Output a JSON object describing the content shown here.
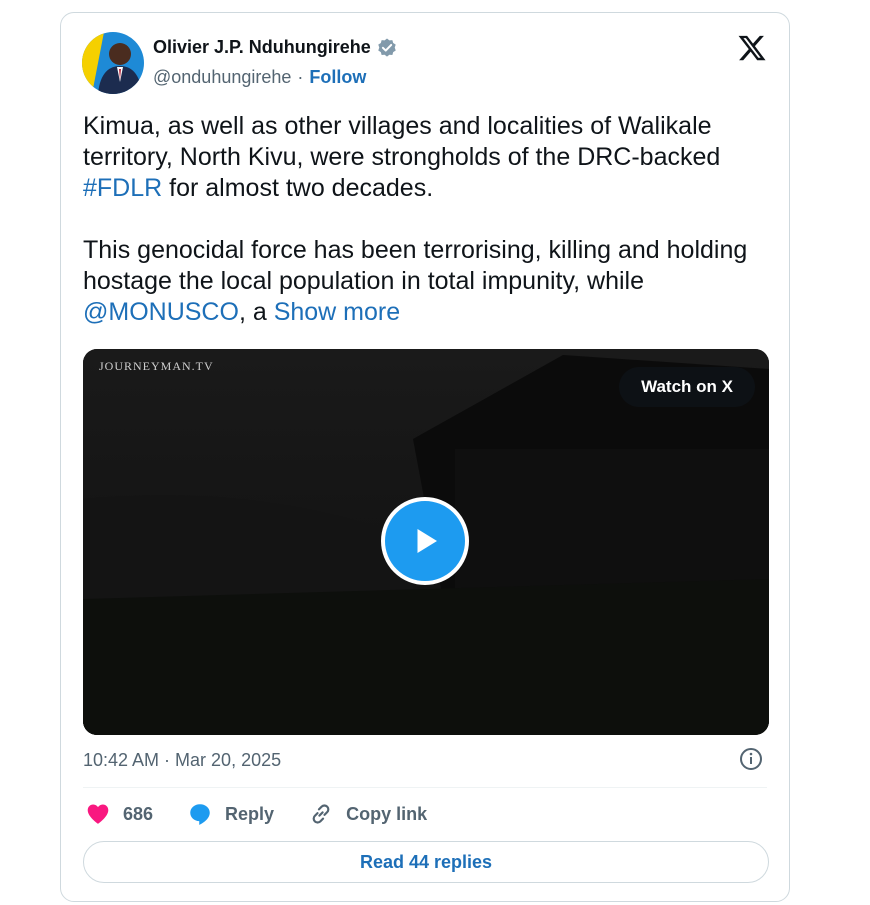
{
  "author": {
    "name": "Olivier J.P. Nduhungirehe",
    "handle": "@onduhungirehe",
    "separator": "·",
    "follow_label": "Follow",
    "verified_color": "#829aab"
  },
  "tweet": {
    "text_part1": "Kimua, as well as other villages and localities of Walikale territory, North Kivu, were strongholds of the DRC-backed ",
    "hashtag": "#FDLR",
    "text_part2": " for almost two decades.\n\nThis genocidal force has been terrorising, killing and holding hostage the local population in total impunity, while ",
    "mention": "@MONUSCO",
    "text_part3": ", a ",
    "show_more": "Show more"
  },
  "media": {
    "watermark": "Journeyman.tv",
    "watch_label": "Watch on X",
    "play_icon": "play-icon"
  },
  "meta": {
    "timestamp": "10:42 AM · Mar 20, 2025"
  },
  "actions": {
    "like_count": "686",
    "reply_label": "Reply",
    "copy_label": "Copy link"
  },
  "footer": {
    "read_replies_label": "Read 44 replies"
  },
  "colors": {
    "link": "#1d6fb8",
    "heart": "#f91880",
    "reply_bubble": "#1d9bf0",
    "play_button": "#1d9bf0"
  }
}
